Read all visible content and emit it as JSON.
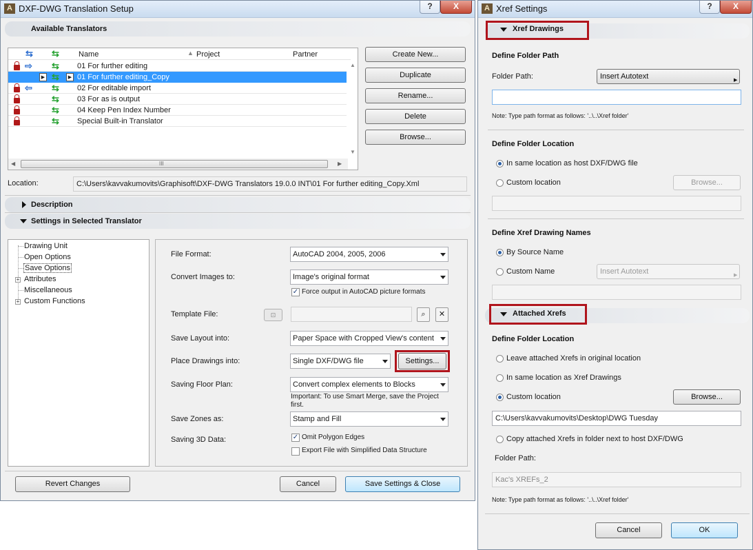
{
  "left": {
    "title": "DXF-DWG Translation Setup",
    "help": "?",
    "close": "X",
    "available_title": "Available Translators",
    "columns": [
      "Name",
      "Project",
      "Partner"
    ],
    "rows": [
      {
        "name": "01 For further editing"
      },
      {
        "name": "01 For further editing_Copy"
      },
      {
        "name": "02 For editable import"
      },
      {
        "name": "03 For as is output"
      },
      {
        "name": "04 Keep Pen Index Number"
      },
      {
        "name": "Special Built-in Translator"
      }
    ],
    "hscroll_grip": "III",
    "buttons": {
      "create": "Create New...",
      "duplicate": "Duplicate",
      "rename": "Rename...",
      "delete": "Delete",
      "browse": "Browse..."
    },
    "location_label": "Location:",
    "location_value": "C:\\Users\\kavvakumovits\\Graphisoft\\DXF-DWG Translators 19.0.0 INT\\01 For further editing_Copy.Xml",
    "description_title": "Description",
    "settings_title": "Settings in Selected Translator",
    "tree": [
      "Drawing Unit",
      "Open Options",
      "Save Options",
      "Attributes",
      "Miscellaneous",
      "Custom Functions"
    ],
    "form": {
      "file_format_label": "File Format:",
      "file_format_value": "AutoCAD 2004, 2005, 2006",
      "convert_images_label": "Convert Images to:",
      "convert_images_value": "Image's original format",
      "force_output": "Force output in AutoCAD picture formats",
      "template_label": "Template File:",
      "save_layout_label": "Save Layout into:",
      "save_layout_value": "Paper Space with Cropped View's content",
      "place_drawings_label": "Place Drawings into:",
      "place_drawings_value": "Single DXF/DWG file",
      "settings_button": "Settings...",
      "floor_plan_label": "Saving Floor Plan:",
      "floor_plan_value": "Convert complex elements to Blocks",
      "floor_plan_note": "Important: To use Smart Merge, save the Project first.",
      "zones_label": "Save Zones as:",
      "zones_value": "Stamp and Fill",
      "saving3d_label": "Saving 3D Data:",
      "omit_edges": "Omit Polygon Edges",
      "export_simplified": "Export File with Simplified Data Structure"
    },
    "revert": "Revert Changes",
    "cancel": "Cancel",
    "save_close": "Save Settings & Close"
  },
  "right": {
    "title": "Xref Settings",
    "help": "?",
    "close": "X",
    "xref_drawings_title": "Xref Drawings",
    "define_path_title": "Define Folder Path",
    "folder_path_label": "Folder Path:",
    "insert_autotext": "Insert Autotext",
    "folder_path_value": "",
    "note1": "Note: Type path format as follows:   '..\\..\\Xref folder'",
    "define_location_title": "Define Folder Location",
    "radio_same_host": "In same location as host DXF/DWG file",
    "radio_custom_location": "Custom location",
    "browse_disabled": "Browse...",
    "custom_location_value": "",
    "define_names_title": "Define Xref Drawing Names",
    "radio_source_name": "By Source Name",
    "radio_custom_name": "Custom Name",
    "insert_autotext_disabled": "Insert Autotext",
    "custom_name_value": "",
    "attached_title": "Attached Xrefs",
    "attached_location_title": "Define Folder Location",
    "radio_leave": "Leave attached Xrefs in original location",
    "radio_same_xref": "In same location as Xref Drawings",
    "radio_custom2": "Custom location",
    "browse2": "Browse...",
    "custom_path_value": "C:\\Users\\kavvakumovits\\Desktop\\DWG Tuesday",
    "radio_copy": "Copy attached Xrefs in folder next to host DXF/DWG",
    "folder_path2_label": "Folder Path:",
    "folder_path2_value": "Kac's XREFs_2",
    "note2": "Note: Type path format as follows:   '..\\..\\Xref folder'",
    "cancel": "Cancel",
    "ok": "OK"
  }
}
